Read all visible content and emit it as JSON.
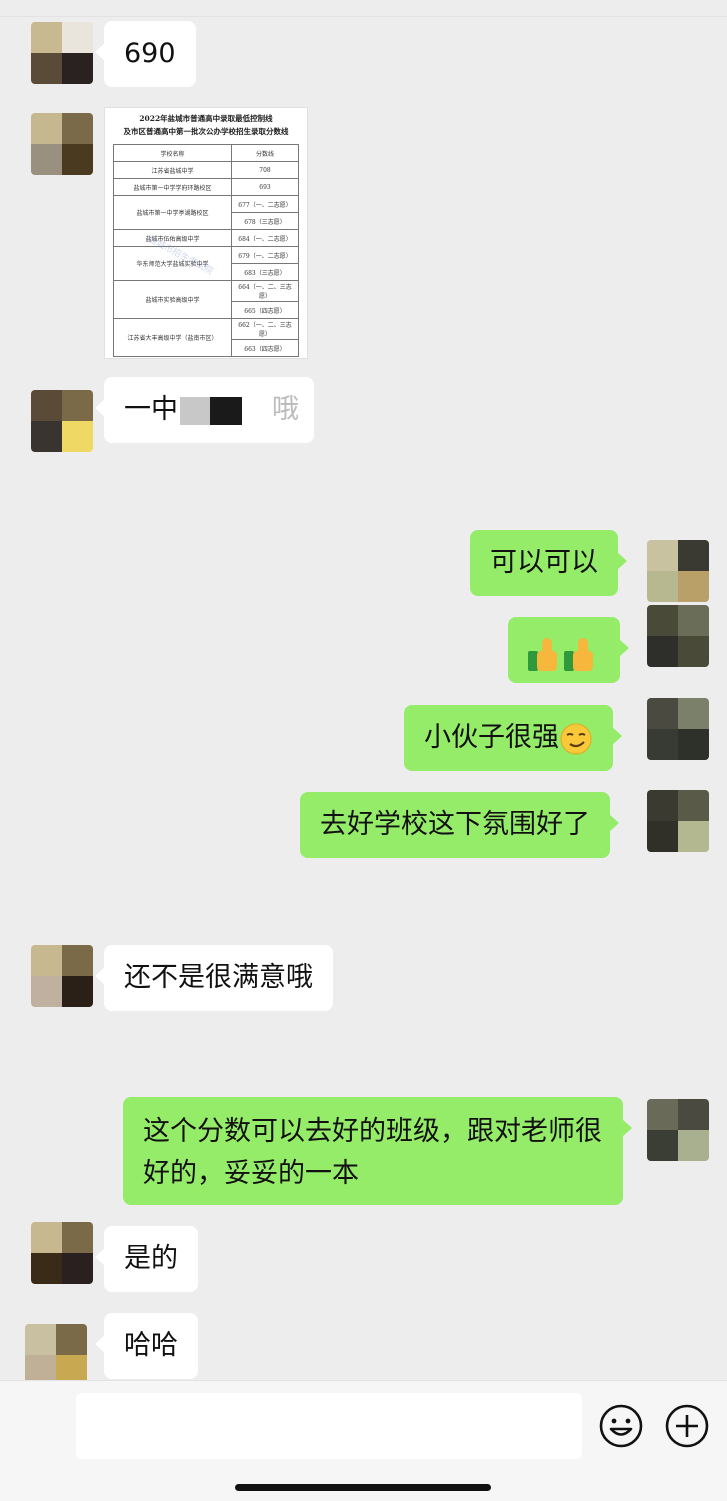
{
  "messages": {
    "m1": "690",
    "m3_prefix": "一中",
    "m3_suffix": "哦",
    "m4": "可以可以",
    "m6": "小伙子很强",
    "m7": "去好学校这下氛围好了",
    "m8": "还不是很满意哦",
    "m9": "这个分数可以去好的班级，跟对老师很好的，妥妥的一本",
    "m10": "是的",
    "m11": "哈哈"
  },
  "image_message": {
    "title_line1": "2022年盐城市普通高中录取最低控制线",
    "title_line2": "及市区普通高中第一批次公办学校招生录取分数线",
    "header_school": "学校名称",
    "header_score": "分数线",
    "rows": [
      {
        "school": "江苏省盐城中学",
        "scores": [
          "708"
        ]
      },
      {
        "school": "盐城市第一中学学府环路校区",
        "scores": [
          "693"
        ]
      },
      {
        "school": "盐城市第一中学亭湖路校区",
        "scores": [
          "677（一、二志愿）",
          "678（三志愿）"
        ]
      },
      {
        "school": "盐城市伍佑高级中学",
        "scores": [
          "684（一、二志愿）"
        ]
      },
      {
        "school": "华东师范大学盐城实验中学",
        "scores": [
          "679（一、二志愿）",
          "683（三志愿）"
        ]
      },
      {
        "school": "盐城市实验高级中学",
        "scores": [
          "664（一、二、三志愿）",
          "665（四志愿）"
        ]
      },
      {
        "school": "江苏省大丰高级中学（盐南市区）",
        "scores": [
          "662（一、二、三志愿）",
          "663（四志愿）"
        ]
      }
    ],
    "watermark": "盐城市招生考试院"
  },
  "icons": {
    "emoji_button": "smiley-face-icon",
    "plus_button": "plus-circle-icon"
  },
  "colors": {
    "background": "#ededed",
    "incoming_bubble": "#ffffff",
    "outgoing_bubble": "#95ec69"
  }
}
